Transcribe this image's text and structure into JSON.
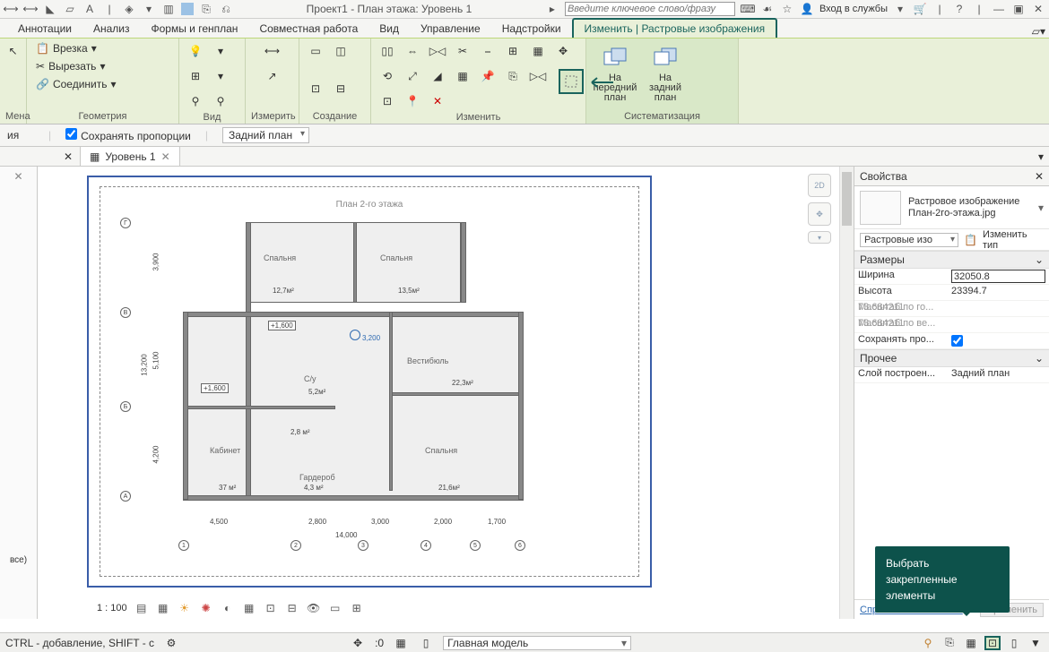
{
  "topbar": {
    "title": "Проект1 - План этажа: Уровень 1",
    "search_placeholder": "Введите ключевое слово/фразу",
    "login": "Вход в службы"
  },
  "tabs": [
    "Аннотации",
    "Анализ",
    "Формы и генплан",
    "Совместная работа",
    "Вид",
    "Управление",
    "Надстройки",
    "Изменить | Растровые изображения"
  ],
  "ribbon": {
    "panels": {
      "p0": "Мена",
      "p1": "Геометрия",
      "p2": "Вид",
      "p3": "Измерить",
      "p4": "Создание",
      "p5": "Изменить",
      "p6": "Систематизация"
    },
    "cut": "Вырезать",
    "paste": "Врезка",
    "join": "Соединить",
    "front": "На передний план",
    "back": "На задний план"
  },
  "optbar": {
    "keep": "Сохранять пропорции",
    "order": "Задний план"
  },
  "doctabs": {
    "level": "Уровень 1"
  },
  "floorplan": {
    "title": "План 2-го этажа",
    "rooms": {
      "r1": "Спальня",
      "r2": "Спальня",
      "r3": "Вестибюль",
      "r4": "Кабинет",
      "r5": "Гардероб",
      "r6": "Спальня",
      "r7": "С/у"
    },
    "dims": {
      "d1": "12,7м²",
      "d2": "13,5м²",
      "d3": "22,3м²",
      "d4": "37 м²",
      "d5": "4,3 м²",
      "d6": "21,6м²",
      "d7": "5,2м²",
      "d8": "2,8 м²",
      "d9": "+1,600",
      "d10": "+1,600",
      "d11": "3,200"
    },
    "bottom": {
      "b1": "4,500",
      "b2": "2,800",
      "b3": "3,000",
      "b4": "2,000",
      "b5": "1,700",
      "b6": "14,000"
    },
    "left": {
      "l1": "3,900",
      "l2": "5,100",
      "l3": "4,200",
      "l4": "13,200"
    },
    "grids": {
      "g1": "1",
      "g2": "2",
      "g3": "3",
      "g4": "4",
      "g5": "5",
      "g6": "6",
      "gA": "A",
      "gB": "Б",
      "gC": "В",
      "gD": "Г"
    }
  },
  "properties": {
    "title": "Свойства",
    "typename": "Растровое изображение\nПлан-2го-этажа.jpg",
    "instcombo": "Растровые изо",
    "edittype": "Изменить тип",
    "grp1": "Размеры",
    "grp2": "Прочее",
    "rows": {
      "width_l": "Ширина",
      "width_v": "32050.8",
      "height_l": "Высота",
      "height_v": "23394.7",
      "sx_l": "Масштаб по го...",
      "sx_v": "73.684211",
      "sy_l": "Масштаб по ве...",
      "sy_v": "73.684211",
      "keep_l": "Сохранять про...",
      "layer_l": "Слой построен...",
      "layer_v": "Задний план"
    },
    "help": "Справка по свойствам",
    "apply": "Применить"
  },
  "tooltip": "Выбрать закрепленные элементы",
  "viewbar": {
    "scale": "1 : 100"
  },
  "status": {
    "hint": "CTRL - добавление, SHIFT - с",
    "snap": ":0",
    "model": "Главная модель",
    "all": "все)"
  }
}
